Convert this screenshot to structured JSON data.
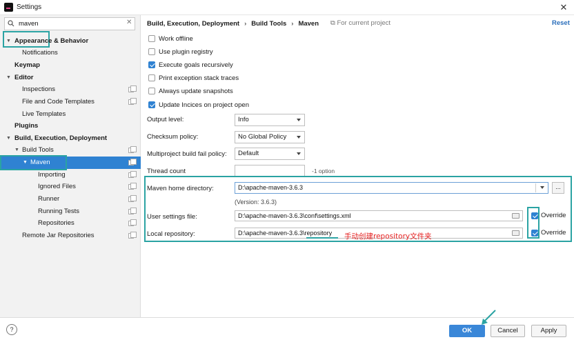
{
  "window": {
    "title": "Settings",
    "close_label": "✕"
  },
  "search": {
    "value": "maven",
    "clear_label": "✕"
  },
  "sidebar": {
    "items": [
      {
        "label": "Appearance & Behavior"
      },
      {
        "label": "Notifications"
      },
      {
        "label": "Keymap"
      },
      {
        "label": "Editor"
      },
      {
        "label": "Inspections"
      },
      {
        "label": "File and Code Templates"
      },
      {
        "label": "Live Templates"
      },
      {
        "label": "Plugins"
      },
      {
        "label": "Build, Execution, Deployment"
      },
      {
        "label": "Build Tools"
      },
      {
        "label": "Maven"
      },
      {
        "label": "Importing"
      },
      {
        "label": "Ignored Files"
      },
      {
        "label": "Runner"
      },
      {
        "label": "Running Tests"
      },
      {
        "label": "Repositories"
      },
      {
        "label": "Remote Jar Repositories"
      }
    ]
  },
  "breadcrumb": {
    "part1": "Build, Execution, Deployment",
    "part2": "Build Tools",
    "part3": "Maven",
    "separator": "›"
  },
  "project_note": "For current project",
  "reset_label": "Reset",
  "checkboxes": [
    {
      "label": "Work offline",
      "checked": false
    },
    {
      "label": "Use plugin registry",
      "checked": false
    },
    {
      "label": "Execute goals recursively",
      "checked": true
    },
    {
      "label": "Print exception stack traces",
      "checked": false
    },
    {
      "label": "Always update snapshots",
      "checked": false
    },
    {
      "label": "Update Incices on project open",
      "checked": true
    }
  ],
  "form": {
    "output_level_label": "Output level:",
    "output_level_value": "Info",
    "checksum_label": "Checksum policy:",
    "checksum_value": "No Global Policy",
    "multiproject_label": "Multiproject build fail policy:",
    "multiproject_value": "Default",
    "thread_label": "Thread count",
    "thread_hint": "-1 option",
    "maven_home_label": "Maven home directory:",
    "maven_home_value": "D:\\apache-maven-3.6.3",
    "browse_label": "...",
    "version_text": "(Version: 3.6.3)",
    "user_settings_label": "User settings file:",
    "user_settings_value": "D:\\apache-maven-3.6.3\\conf\\settings.xml",
    "local_repo_label": "Local repository:",
    "local_repo_value": "D:\\apache-maven-3.6.3\\repository",
    "override_label": "Override"
  },
  "annotation": "手动创建repository文件夹",
  "footer": {
    "help_label": "?",
    "ok_label": "OK",
    "cancel_label": "Cancel",
    "apply_label": "Apply"
  },
  "colors": {
    "accent": "#2f82d2",
    "highlight": "#2aa3a3",
    "annotation": "#e52222"
  }
}
